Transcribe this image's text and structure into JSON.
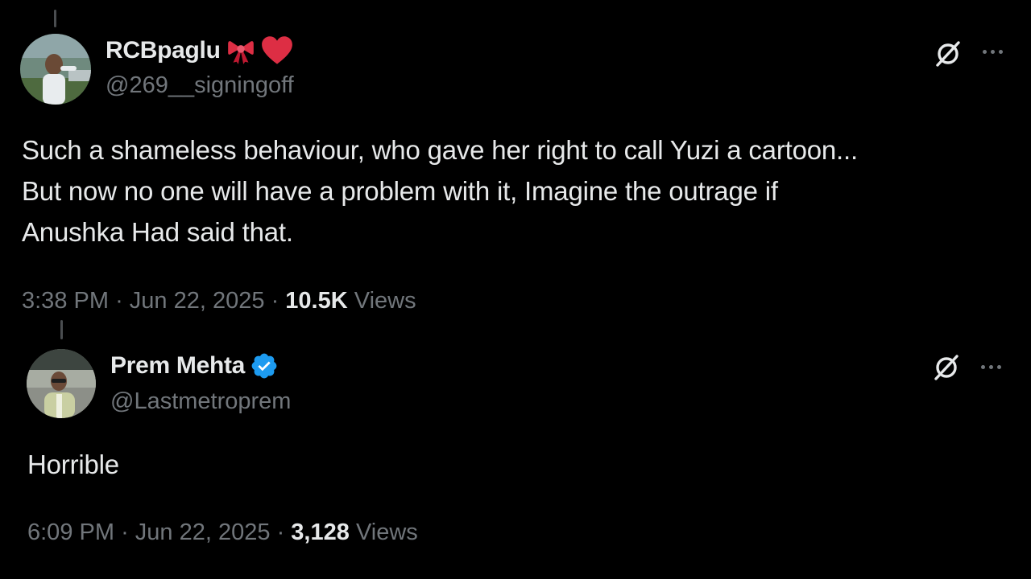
{
  "tweets": [
    {
      "display_name": "RCBpaglu",
      "name_emojis": [
        "ribbon-icon",
        "red-heart-icon"
      ],
      "handle": "@269__signingoff",
      "text_lines": [
        "Such a shameless behaviour, who gave her right to call Yuzi a cartoon...",
        "But now no one will have a problem with it, Imagine the outrage if",
        "Anushka Had said that."
      ],
      "time": "3:38 PM",
      "sep1": "·",
      "date": "Jun 22, 2025",
      "sep2": "·",
      "views_count": "10.5K",
      "views_label": "Views",
      "verified": false
    },
    {
      "display_name": "Prem Mehta",
      "handle": "@Lastmetroprem",
      "text_lines": [
        "Horrible"
      ],
      "time": "6:09 PM",
      "sep1": "·",
      "date": "Jun 22, 2025",
      "sep2": "·",
      "views_count": "3,128",
      "views_label": "Views",
      "verified": true
    }
  ],
  "colors": {
    "background": "#000000",
    "primary_text": "#e7e9ea",
    "secondary_text": "#71767b",
    "verified_blue": "#1d9bf0",
    "heart_red": "#e0245e"
  }
}
